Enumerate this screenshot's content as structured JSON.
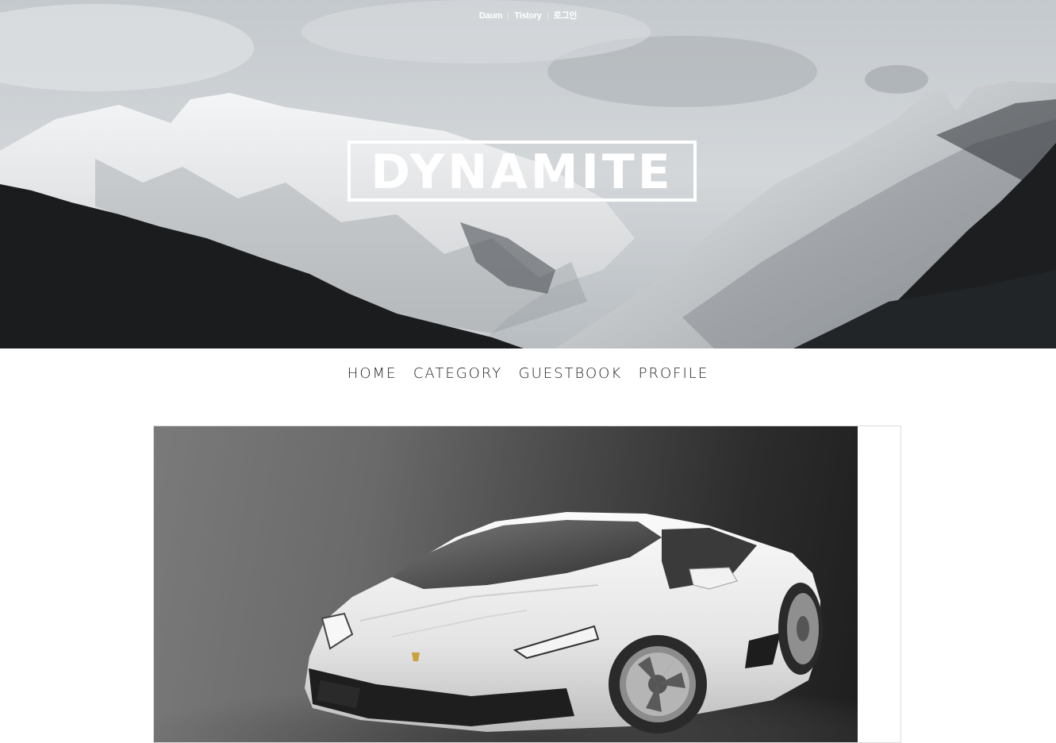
{
  "topbar": {
    "links": [
      "Daum",
      "Tistory",
      "로그인"
    ]
  },
  "blog": {
    "title": "DYNAMITE"
  },
  "nav": {
    "items": [
      "HOME",
      "CATEGORY",
      "GUESTBOOK",
      "PROFILE"
    ]
  },
  "icons": {
    "hero_image": "snowy-mountain-photo",
    "post_image": "white-sports-car-photo"
  },
  "colors": {
    "nav_text": "#222222",
    "logo": "#ffffff"
  }
}
